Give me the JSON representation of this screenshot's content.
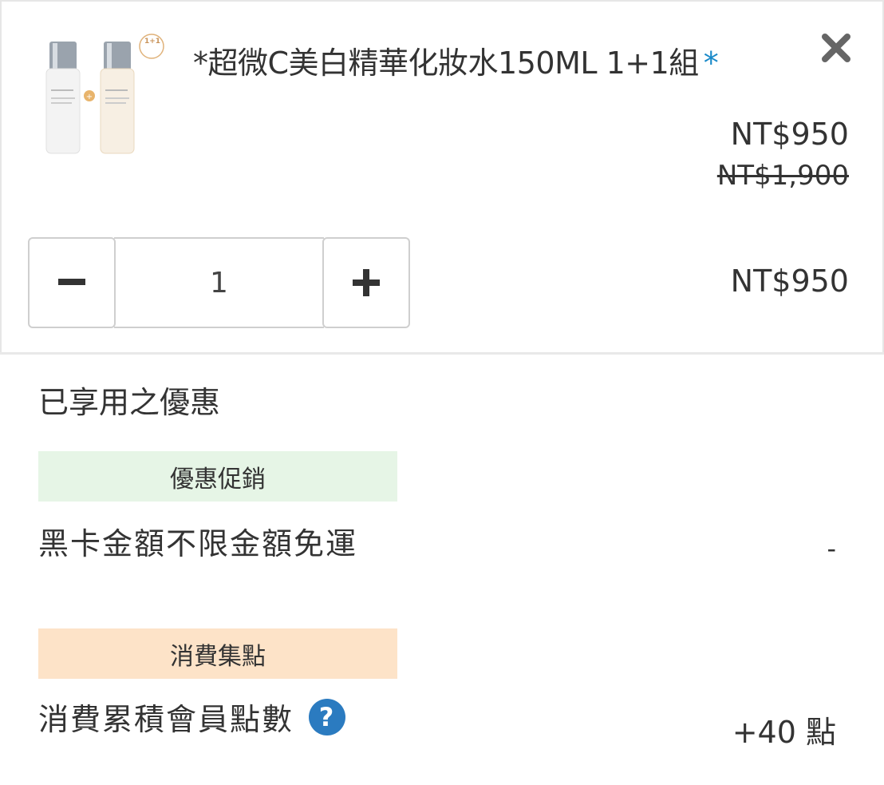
{
  "product": {
    "title": "*超微C美白精華化妝水150ML 1+1組",
    "title_marker": "*",
    "image_badge": "1+1",
    "price_sale": "NT$950",
    "price_original": "NT$1,900",
    "quantity": "1",
    "line_total": "NT$950"
  },
  "discounts": {
    "section_title": "已享用之優惠",
    "promo_tag": "優惠促銷",
    "promo_label": "黑卡金額不限金額免運",
    "promo_value": "-",
    "points_tag": "消費集點",
    "points_label": "消費累積會員點數",
    "points_value": "+40 點"
  },
  "colors": {
    "asterisk": "#1a8ac9",
    "help_icon": "#2b7bc0",
    "promo_tag_bg": "#e6f5e6",
    "points_tag_bg": "#fde3c8"
  }
}
